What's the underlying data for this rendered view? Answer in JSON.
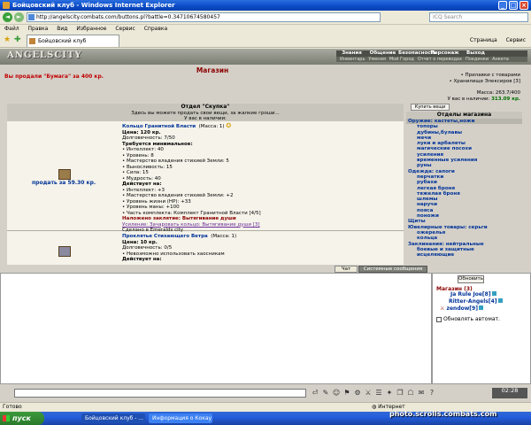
{
  "window": {
    "title": "Бойцовский клуб - Windows Internet Explorer"
  },
  "browser": {
    "url": "http://angelscity.combats.com/buttons.pl?battle=0.34710674580457",
    "search_placeholder": "ICQ Search",
    "menu": [
      "Файл",
      "Правка",
      "Вид",
      "Избранное",
      "Сервис",
      "Справка"
    ],
    "tab_title": "Бойцовский клуб",
    "tools": [
      "Страница",
      "Сервис"
    ]
  },
  "site": {
    "logo": "ANGELSCITY",
    "topnav": [
      "Знания",
      "Общение",
      "Безопасность",
      "Персонаж",
      "Выход"
    ],
    "subnav": [
      "Инвентарь",
      "Умения",
      "Мой Город",
      "Отчет о переводах",
      "Поединки",
      "Анкета"
    ]
  },
  "shop": {
    "title": "Магазин",
    "sold_message": "Вы продали \"Бумага\" за 400 кр.",
    "right_info": {
      "links": [
        "Прилавки с товарами",
        "Хранилище Элексиров [3]"
      ],
      "mass": "Масса: 263.7/400",
      "money_label": "У вас в наличии:",
      "money": "313.09 кр."
    },
    "section_title": "Отдел \"Скупка\"",
    "section_desc": "Здесь вы можете продать свои вещи, за жалкие гроши...",
    "section_have": "У вас в наличии:",
    "buy_button": "Купить вещи",
    "departments_title": "Отделы магазина",
    "departments": [
      {
        "label": "Оружие: кастеты,ножи",
        "type": "cat",
        "sel": true
      },
      {
        "label": "топоры",
        "type": "sub"
      },
      {
        "label": "дубины,булавы",
        "type": "sub"
      },
      {
        "label": "мечи",
        "type": "sub"
      },
      {
        "label": "луки и арбалеты",
        "type": "sub"
      },
      {
        "label": "магические посохи",
        "type": "sub"
      },
      {
        "label": "усиления",
        "type": "sub"
      },
      {
        "label": "временные усиления",
        "type": "sub"
      },
      {
        "label": "руны",
        "type": "sub"
      },
      {
        "label": "Одежда: сапоги",
        "type": "cat"
      },
      {
        "label": "перчатки",
        "type": "sub"
      },
      {
        "label": "рубахи",
        "type": "sub"
      },
      {
        "label": "легкая броня",
        "type": "sub"
      },
      {
        "label": "тяжелая броня",
        "type": "sub"
      },
      {
        "label": "шлемы",
        "type": "sub"
      },
      {
        "label": "наручи",
        "type": "sub"
      },
      {
        "label": "пояса",
        "type": "sub"
      },
      {
        "label": "поножи",
        "type": "sub"
      },
      {
        "label": "Щиты",
        "type": "cat"
      },
      {
        "label": "Ювелирные товары: серьги",
        "type": "cat"
      },
      {
        "label": "ожерелья",
        "type": "sub"
      },
      {
        "label": "кольца",
        "type": "sub"
      },
      {
        "label": "Заклинания: нейтральные",
        "type": "cat"
      },
      {
        "label": "боевые и защитные",
        "type": "sub"
      },
      {
        "label": "исцеляющие",
        "type": "sub"
      }
    ],
    "item1": {
      "name": "Кольцо Гранитной Власти",
      "mass": "(Масса: 1)",
      "sell": "продать за 59.30 кр.",
      "lines": [
        "Цена: 120 кр.",
        "Долговечность: 7/50",
        "Требуется минимальное:",
        "• Интеллект: 40",
        "• Уровень: 8",
        "• Мастерство владения стихией Земли: 5",
        "• Выносливость: 15",
        "• Сила: 15",
        "• Мудрость: 40",
        "Действует на:",
        "• Интеллект: +3",
        "• Мастерство владения стихией Земли: +2",
        "• Уровень жизни (HP): +33",
        "• Уровень маны: +100",
        "• Часть комплекта: Комплект Гранитной Власти [4/5]",
        "Наложено заклятие: Вытягивание души",
        "Усиление: Зачаровать кольцо: Вытягивание души [3]",
        "Сделано в Emeralds city"
      ]
    },
    "item2": {
      "name": "Проклятье Стихающего Ветра",
      "mass": "(Масса: 1)",
      "lines": [
        "Цена: 10 кр.",
        "Долговечность: 0/5",
        "• Невозможно использовать хаосникам",
        "Действует на:"
      ]
    }
  },
  "chat": {
    "tabs": [
      "Чат",
      "Системные сообщения"
    ],
    "refresh_button": "Обновить",
    "shop_header": "Магазин (3)",
    "users": [
      "Ja Rule Joe[8]",
      "Ritter-Angels[4]",
      "zendow[9]"
    ],
    "auto_update": "Обновлять автомат.",
    "clock": "02:28"
  },
  "statusbar": {
    "left": "Готово",
    "zone": "Интернет"
  },
  "taskbar": {
    "start": "пуск",
    "items": [
      "Бойцовский клуб - ...",
      "Информация о Кокау..."
    ]
  },
  "watermark": "photo.scrolls.combats.com"
}
